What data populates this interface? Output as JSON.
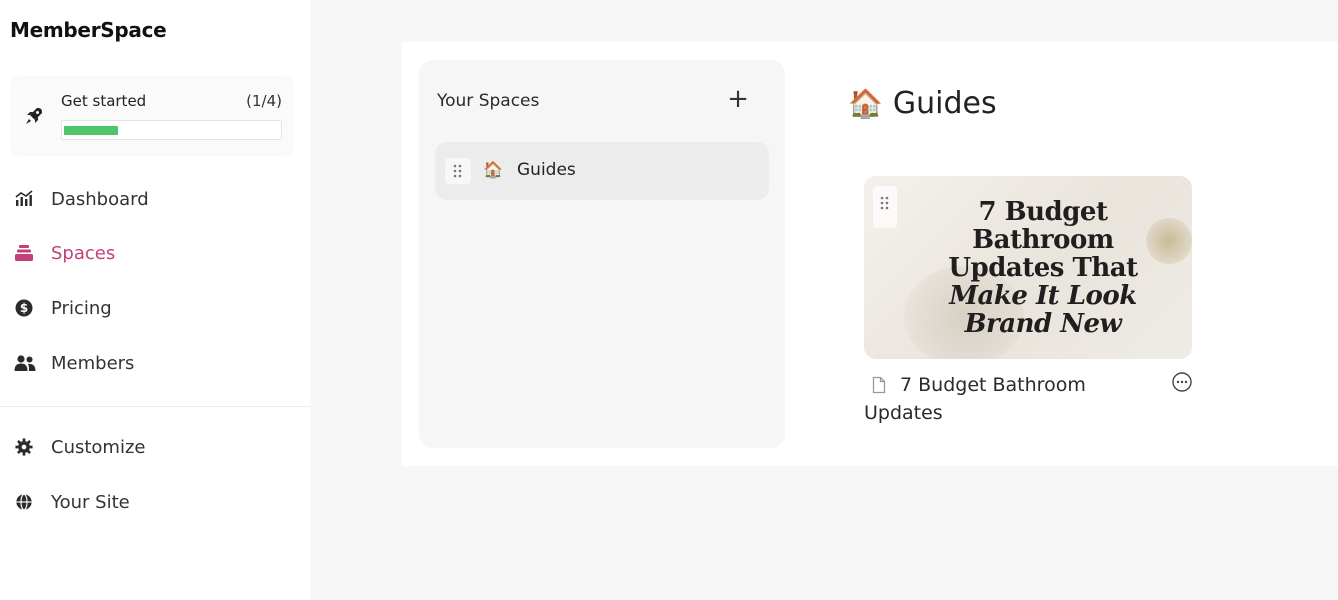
{
  "app": {
    "logo_text": "MemberSpace"
  },
  "onboarding": {
    "label": "Get started",
    "count": "(1/4)",
    "progress_fraction": 0.25,
    "progress_color": "#4cc56d"
  },
  "nav": {
    "primary": [
      {
        "id": "dashboard",
        "label": "Dashboard",
        "icon": "chart-icon"
      },
      {
        "id": "spaces",
        "label": "Spaces",
        "icon": "stack-icon",
        "active": true
      },
      {
        "id": "pricing",
        "label": "Pricing",
        "icon": "dollar-circle-icon"
      },
      {
        "id": "members",
        "label": "Members",
        "icon": "users-icon"
      }
    ],
    "secondary": [
      {
        "id": "customize",
        "label": "Customize",
        "icon": "gear-icon"
      },
      {
        "id": "your-site",
        "label": "Your Site",
        "icon": "globe-icon"
      }
    ],
    "active_color": "#c2417a"
  },
  "spaces_panel": {
    "title": "Your Spaces",
    "add_label": "+",
    "items": [
      {
        "emoji": "🏠",
        "name": "Guides"
      }
    ]
  },
  "space_detail": {
    "emoji": "🏠",
    "title": "Guides",
    "posts": [
      {
        "thumbnail_lines": [
          "7 Budget",
          "Bathroom",
          "Updates That",
          "Make It Look",
          "Brand New"
        ],
        "title": "7 Budget Bathroom Updates",
        "icon": "document-icon",
        "menu_icon": "more-horizontal-icon"
      }
    ]
  }
}
